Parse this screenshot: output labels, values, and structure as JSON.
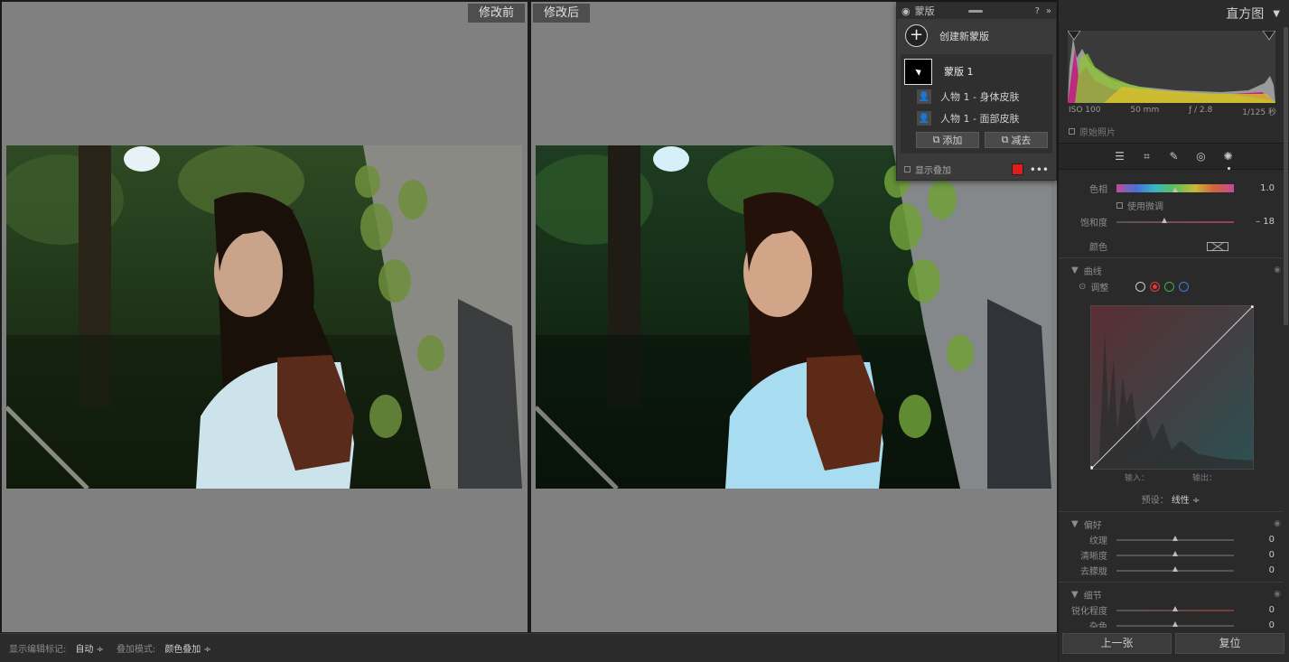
{
  "compare": {
    "before_label": "修改前",
    "after_label": "修改后"
  },
  "mask_panel": {
    "title": "蒙版",
    "help_icon": "?",
    "collapse_icon": "»",
    "create_label": "创建新蒙版",
    "mask_name": "蒙版 1",
    "sub_items": [
      {
        "label": "人物 1 - 身体皮肤"
      },
      {
        "label": "人物 1 - 面部皮肤"
      }
    ],
    "add_button": "添加",
    "subtract_button": "减去",
    "show_overlay": "显示叠加",
    "overlay_color": "#e01b1b"
  },
  "bottombar": {
    "show_edit_pins": "显示编辑标记:",
    "show_edit_pins_value": "自动 ÷",
    "overlay_mode": "叠加模式:",
    "overlay_mode_value": "颜色叠加 ÷"
  },
  "right_panel": {
    "histogram_title": "直方图",
    "histogram_meta": {
      "iso": "ISO 100",
      "focal": "50 mm",
      "aperture": "ƒ / 2.8",
      "shutter": "1/125 秒"
    },
    "original_photo": "原始照片",
    "hue": {
      "label": "色相",
      "value": "1.0",
      "position": 0.5
    },
    "fine_adjust": "使用微调",
    "saturation": {
      "label": "饱和度",
      "value": "– 18",
      "position": 0.41
    },
    "color_label": "颜色",
    "curve_section": "曲线",
    "curve_adjust": "调整",
    "curve_input": "输入：",
    "curve_output": "输出：",
    "preset_label": "预设：",
    "preset_value": "线性 ÷",
    "prefs_section": "偏好",
    "prefs_sliders": [
      {
        "label": "纹理",
        "value": "0",
        "position": 0.5
      },
      {
        "label": "清晰度",
        "value": "0",
        "position": 0.5
      },
      {
        "label": "去朦胧",
        "value": "0",
        "position": 0.5
      }
    ],
    "detail_section": "细节",
    "detail_sliders": [
      {
        "label": "锐化程度",
        "value": "0",
        "position": 0.5
      },
      {
        "label": "杂色",
        "value": "0",
        "position": 0.5
      }
    ],
    "prev_button": "上一张",
    "reset_button": "复位",
    "accent": "#e01b1b"
  }
}
